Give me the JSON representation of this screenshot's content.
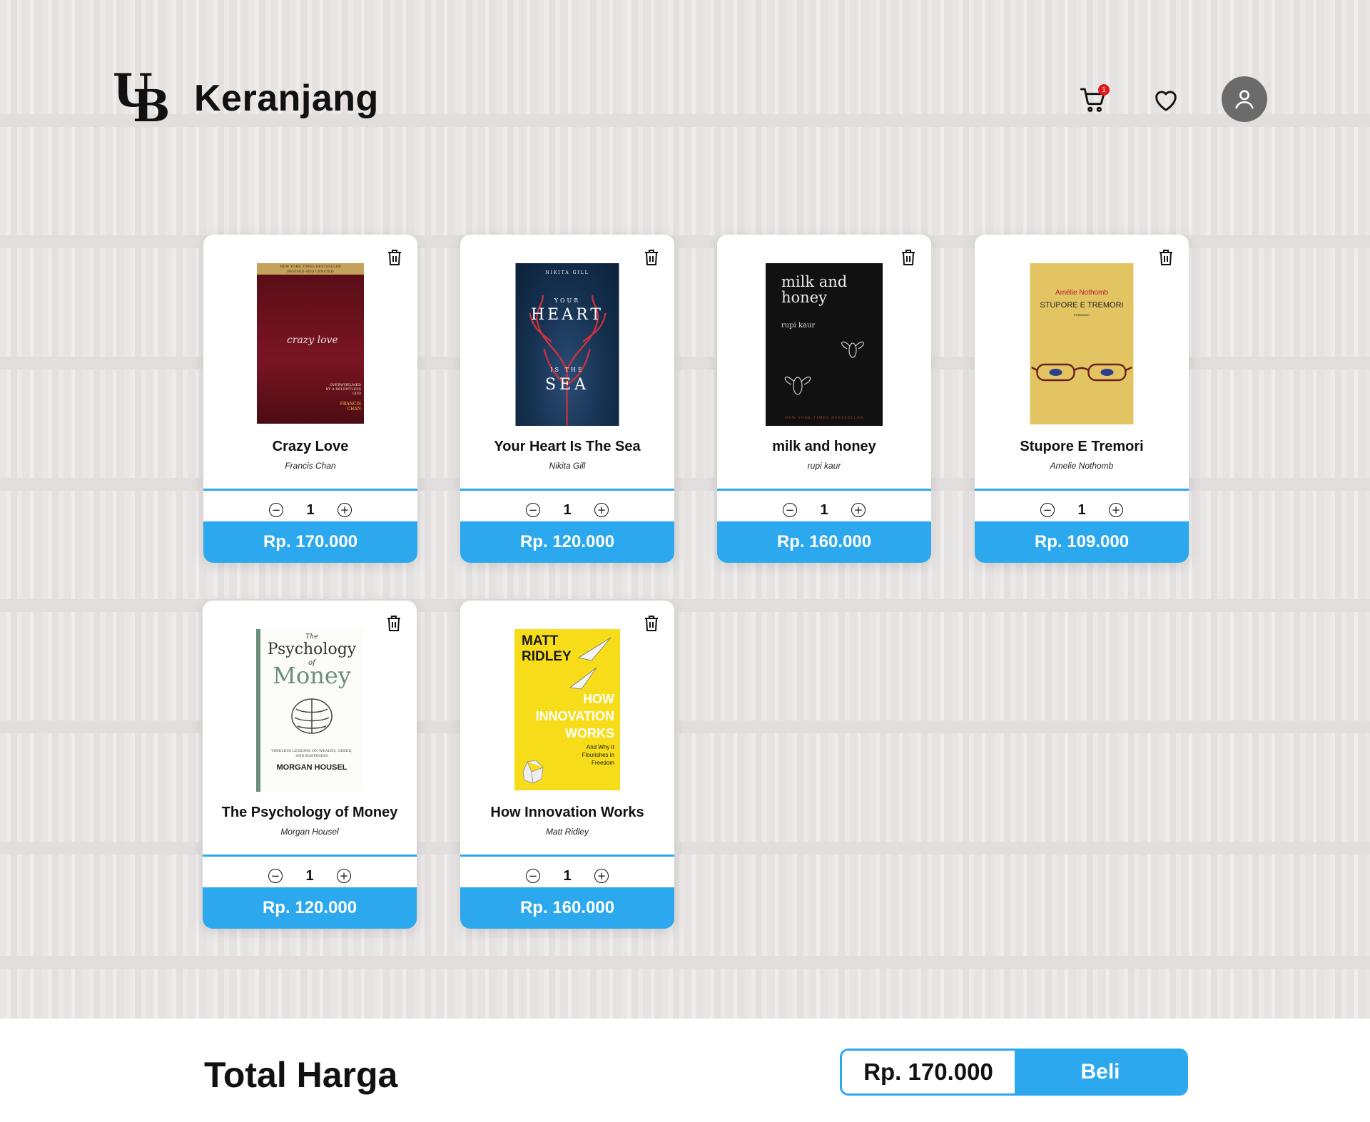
{
  "header": {
    "logo_text_u": "U",
    "logo_text_b": "B",
    "title": "Keranjang",
    "cart_badge": "1",
    "icons": [
      "cart-icon",
      "heart-icon",
      "user-icon"
    ]
  },
  "cart": {
    "items": [
      {
        "title": "Crazy Love",
        "author": "Francis Chan",
        "quantity": "1",
        "price": "Rp. 170.000",
        "cover_text": [
          "NEW YORK TIMES BESTSELLER",
          "REVISED AND UPDATED",
          "crazy love",
          "OVERWHELMED BY A RELENTLESS GOD",
          "FRANCIS CHAN"
        ]
      },
      {
        "title": "Your Heart Is The Sea",
        "author": "Nikita Gill",
        "quantity": "1",
        "price": "Rp. 120.000",
        "cover_text": [
          "NIKITA GILL",
          "YOUR",
          "HEART",
          "IS THE",
          "SEA"
        ]
      },
      {
        "title": "milk and honey",
        "author": "rupi kaur",
        "quantity": "1",
        "price": "Rp. 160.000",
        "cover_text": [
          "milk and",
          "honey",
          "rupi kaur",
          "NEW YORK TIMES BESTSELLER"
        ]
      },
      {
        "title": "Stupore E Tremori",
        "author": "Amelie Nothomb",
        "quantity": "1",
        "price": "Rp. 109.000",
        "cover_text": [
          "Amélie Nothomb",
          "STUPORE E TREMORI",
          "romanzo"
        ]
      },
      {
        "title": "The Psychology of Money",
        "author": "Morgan Housel",
        "quantity": "1",
        "price": "Rp. 120.000",
        "cover_text": [
          "The",
          "Psychology",
          "of",
          "Money",
          "TIMELESS LESSONS ON WEALTH, GREED, AND HAPPINESS",
          "MORGAN HOUSEL"
        ]
      },
      {
        "title": "How Innovation Works",
        "author": "Matt Ridley",
        "quantity": "1",
        "price": "Rp. 160.000",
        "cover_text": [
          "MATT",
          "RIDLEY",
          "HOW",
          "INNOVATION",
          "WORKS",
          "And Why It Flourishes in Freedom"
        ]
      }
    ]
  },
  "footer": {
    "total_label": "Total Harga",
    "total_value": "Rp. 170.000",
    "buy_label": "Beli"
  },
  "colors": {
    "accent": "#2ba8ee",
    "badge": "#e01b1b",
    "avatar_bg": "#6b6b6b"
  }
}
